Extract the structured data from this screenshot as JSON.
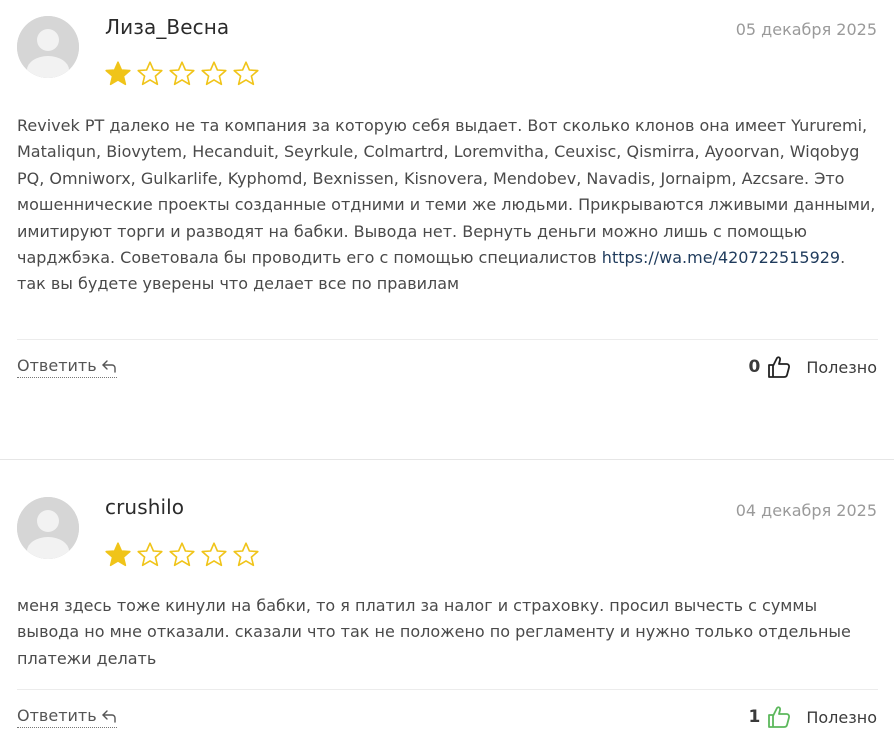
{
  "reviews": [
    {
      "author": "Лиза_Весна",
      "date": "05 декабря 2025",
      "rating": 1,
      "max_rating": 5,
      "text_parts": {
        "before_link": "Revivek PT далеко не та компания за которую себя выдает. Вот сколько клонов она имеет Yururemi, Mataliqun, Biovytem, Hecanduit, Seyrkule, Colmartrd, Loremvitha, Ceuxisc, Qismirra, Ayoorvan, Wiqobyg PQ, Omniworx, Gulkarlife, Kyphomd, Bexnissen, Kisnovera, Mendobev, Navadis, Jornaipm, Azcsare. Это мошеннические проекты созданные отдними и теми же людьми. Прикрываются лживыми данными, имитируют торги и разводят на бабки. Вывода нет. Вернуть деньги можно лишь с помощью чарджбэка. Советовала бы проводить его с помощью специалистов ",
        "link": "https://wa.me/420722515929",
        "after_link": ". так вы будете уверены что делает все по правилам"
      },
      "reply_label": "Ответить",
      "useful_count": "0",
      "useful_label": "Полезно",
      "thumb_color": "#222222"
    },
    {
      "author": "crushilo",
      "date": "04 декабря 2025",
      "rating": 1,
      "max_rating": 5,
      "text_parts": {
        "before_link": "меня здесь тоже кинули на бабки, то я платил за налог и страховку. просил вычесть с суммы вывода но мне отказали. сказали что так не положено по регламенту и нужно только отдельные платежи делать",
        "link": "",
        "after_link": ""
      },
      "reply_label": "Ответить",
      "useful_count": "1",
      "useful_label": "Полезно",
      "thumb_color": "#5cb85c"
    }
  ],
  "colors": {
    "star_filled": "#f0c419",
    "star_empty_stroke": "#f0c419",
    "link": "#1f3b5c"
  },
  "icons": {
    "avatar": "user-avatar-placeholder",
    "star": "star-icon",
    "reply": "reply-arrow-icon",
    "thumb": "thumbs-up-icon"
  }
}
